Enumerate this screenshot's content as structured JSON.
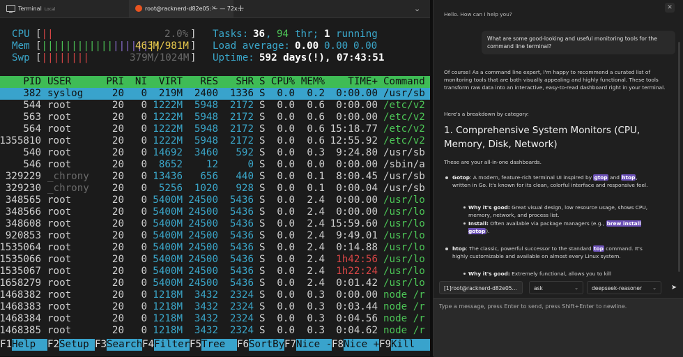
{
  "tabbar": {
    "tab1_title": "Terminal",
    "tab1_sub": "Local",
    "tab2_title": "root@racknerd-d82e05: ~ — 72x…",
    "close": "×",
    "new_tab": "+",
    "overflow": "⌄"
  },
  "meters": {
    "cpu_label": "CPU",
    "cpu_value": "2.0%",
    "mem_label": "Mem",
    "mem_value": "463M/981M",
    "swp_label": "Swp",
    "swp_value": "379M/1024M",
    "tasks_label": "Tasks:",
    "tasks_value": "36",
    "thr_value": "94",
    "thr_label": "thr;",
    "running_value": "1",
    "running_label": "running",
    "load_label": "Load average:",
    "load1": "0.00",
    "load5": "0.00",
    "load15": "0.00",
    "uptime_label": "Uptime:",
    "uptime_value": "592 days(!), 07:43:51"
  },
  "columns": [
    "PID",
    "USER",
    "PRI",
    "NI",
    "VIRT",
    "RES",
    "SHR",
    "S",
    "CPU%",
    "MEM%",
    "TIME+",
    "Command"
  ],
  "processes": [
    {
      "pid": "382",
      "user": "syslog",
      "pri": "20",
      "ni": "0",
      "virt": "219M",
      "res": "2400",
      "shr": "1336",
      "s": "S",
      "cpu": "0.0",
      "mem": "0.2",
      "time": "0:00.00",
      "cmd": "/usr/sb"
    },
    {
      "pid": "544",
      "user": "root",
      "pri": "20",
      "ni": "0",
      "virt": "1222M",
      "res": "5948",
      "shr": "2172",
      "s": "S",
      "cpu": "0.0",
      "mem": "0.6",
      "time": "0:00.00",
      "cmd": "/etc/v2"
    },
    {
      "pid": "563",
      "user": "root",
      "pri": "20",
      "ni": "0",
      "virt": "1222M",
      "res": "5948",
      "shr": "2172",
      "s": "S",
      "cpu": "0.0",
      "mem": "0.6",
      "time": "0:00.00",
      "cmd": "/etc/v2"
    },
    {
      "pid": "564",
      "user": "root",
      "pri": "20",
      "ni": "0",
      "virt": "1222M",
      "res": "5948",
      "shr": "2172",
      "s": "S",
      "cpu": "0.0",
      "mem": "0.6",
      "time": "15:18.77",
      "cmd": "/etc/v2"
    },
    {
      "pid": "1355810",
      "user": "root",
      "pri": "20",
      "ni": "0",
      "virt": "1222M",
      "res": "5948",
      "shr": "2172",
      "s": "S",
      "cpu": "0.0",
      "mem": "0.6",
      "time": "12:55.92",
      "cmd": "/etc/v2"
    },
    {
      "pid": "540",
      "user": "root",
      "pri": "20",
      "ni": "0",
      "virt": "14692",
      "res": "3460",
      "shr": "592",
      "s": "S",
      "cpu": "0.0",
      "mem": "0.3",
      "time": "9:24.80",
      "cmd": "/usr/sb"
    },
    {
      "pid": "546",
      "user": "root",
      "pri": "20",
      "ni": "0",
      "virt": "8652",
      "res": "12",
      "shr": "0",
      "s": "S",
      "cpu": "0.0",
      "mem": "0.0",
      "time": "0:00.00",
      "cmd": "/sbin/a"
    },
    {
      "pid": "329229",
      "user": "_chrony",
      "pri": "20",
      "ni": "0",
      "virt": "13436",
      "res": "656",
      "shr": "440",
      "s": "S",
      "cpu": "0.0",
      "mem": "0.1",
      "time": "8:00.45",
      "cmd": "/usr/sb"
    },
    {
      "pid": "329230",
      "user": "_chrony",
      "pri": "20",
      "ni": "0",
      "virt": "5256",
      "res": "1020",
      "shr": "928",
      "s": "S",
      "cpu": "0.0",
      "mem": "0.1",
      "time": "0:00.04",
      "cmd": "/usr/sb"
    },
    {
      "pid": "348565",
      "user": "root",
      "pri": "20",
      "ni": "0",
      "virt": "5400M",
      "res": "24500",
      "shr": "5436",
      "s": "S",
      "cpu": "0.0",
      "mem": "2.4",
      "time": "0:00.00",
      "cmd": "/usr/lo"
    },
    {
      "pid": "348566",
      "user": "root",
      "pri": "20",
      "ni": "0",
      "virt": "5400M",
      "res": "24500",
      "shr": "5436",
      "s": "S",
      "cpu": "0.0",
      "mem": "2.4",
      "time": "0:00.00",
      "cmd": "/usr/lo"
    },
    {
      "pid": "348608",
      "user": "root",
      "pri": "20",
      "ni": "0",
      "virt": "5400M",
      "res": "24500",
      "shr": "5436",
      "s": "S",
      "cpu": "0.0",
      "mem": "2.4",
      "time": "15:59.60",
      "cmd": "/usr/lo"
    },
    {
      "pid": "920853",
      "user": "root",
      "pri": "20",
      "ni": "0",
      "virt": "5400M",
      "res": "24500",
      "shr": "5436",
      "s": "S",
      "cpu": "0.0",
      "mem": "2.4",
      "time": "9:49.01",
      "cmd": "/usr/lo"
    },
    {
      "pid": "1535064",
      "user": "root",
      "pri": "20",
      "ni": "0",
      "virt": "5400M",
      "res": "24500",
      "shr": "5436",
      "s": "S",
      "cpu": "0.0",
      "mem": "2.4",
      "time": "0:14.88",
      "cmd": "/usr/lo"
    },
    {
      "pid": "1535066",
      "user": "root",
      "pri": "20",
      "ni": "0",
      "virt": "5400M",
      "res": "24500",
      "shr": "5436",
      "s": "S",
      "cpu": "0.0",
      "mem": "2.4",
      "time": "1h42:56",
      "cmd": "/usr/lo"
    },
    {
      "pid": "1535067",
      "user": "root",
      "pri": "20",
      "ni": "0",
      "virt": "5400M",
      "res": "24500",
      "shr": "5436",
      "s": "S",
      "cpu": "0.0",
      "mem": "2.4",
      "time": "1h22:24",
      "cmd": "/usr/lo"
    },
    {
      "pid": "1658279",
      "user": "root",
      "pri": "20",
      "ni": "0",
      "virt": "5400M",
      "res": "24500",
      "shr": "5436",
      "s": "S",
      "cpu": "0.0",
      "mem": "2.4",
      "time": "0:01.42",
      "cmd": "/usr/lo"
    },
    {
      "pid": "1468382",
      "user": "root",
      "pri": "20",
      "ni": "0",
      "virt": "1218M",
      "res": "3432",
      "shr": "2324",
      "s": "S",
      "cpu": "0.0",
      "mem": "0.3",
      "time": "0:00.00",
      "cmd": "node /r"
    },
    {
      "pid": "1468383",
      "user": "root",
      "pri": "20",
      "ni": "0",
      "virt": "1218M",
      "res": "3432",
      "shr": "2324",
      "s": "S",
      "cpu": "0.0",
      "mem": "0.3",
      "time": "0:03.44",
      "cmd": "node /r"
    },
    {
      "pid": "1468384",
      "user": "root",
      "pri": "20",
      "ni": "0",
      "virt": "1218M",
      "res": "3432",
      "shr": "2324",
      "s": "S",
      "cpu": "0.0",
      "mem": "0.3",
      "time": "0:04.56",
      "cmd": "node /r"
    },
    {
      "pid": "1468385",
      "user": "root",
      "pri": "20",
      "ni": "0",
      "virt": "1218M",
      "res": "3432",
      "shr": "2324",
      "s": "S",
      "cpu": "0.0",
      "mem": "0.3",
      "time": "0:04.62",
      "cmd": "node /r"
    }
  ],
  "fkeys": [
    {
      "key": "F1",
      "label": "Help"
    },
    {
      "key": "F2",
      "label": "Setup"
    },
    {
      "key": "F3",
      "label": "Search"
    },
    {
      "key": "F4",
      "label": "Filter"
    },
    {
      "key": "F5",
      "label": "Tree"
    },
    {
      "key": "F6",
      "label": "SortBy"
    },
    {
      "key": "F7",
      "label": "Nice -"
    },
    {
      "key": "F8",
      "label": "Nice +"
    },
    {
      "key": "F9",
      "label": "Kill"
    }
  ],
  "chat": {
    "greeting": "Hello. How can I help you?",
    "user_message": "What are some good-looking and useful monitoring tools for the command line terminal?",
    "intro": "Of course! As a command line expert, I'm happy to recommend a curated list of monitoring tools that are both visually appealing and highly functional. These tools transform raw data into an interactive, easy-to-read dashboard right in your terminal.",
    "breakdown": "Here's a breakdown by category:",
    "heading": "1. Comprehensive System Monitors (CPU, Memory, Disk, Network)",
    "section_intro": "These are your all-in-one dashboards.",
    "gotop_name": "Gotop",
    "gotop_text_a": ": A modern, feature-rich terminal UI inspired by ",
    "gotop_kw1": "gtop",
    "gotop_text_b": " and ",
    "gotop_kw2": "htop",
    "gotop_text_c": ", written in Go. It's known for its clean, colorful interface and responsive feel.",
    "gotop_why_label": "Why it's good:",
    "gotop_why": " Great visual design, low resource usage, shows CPU, memory, network, and process list.",
    "gotop_install_label": "Install:",
    "gotop_install": " Often available via package managers (e.g., ",
    "gotop_install_kw": "brew install gotop",
    "gotop_install_end": ").",
    "htop_name": "htop",
    "htop_text_a": ": The classic, powerful successor to the standard ",
    "htop_kw": "top",
    "htop_text_b": " command. It's highly customizable and available on almost every Linux system.",
    "htop_why_label": "Why it's good:",
    "htop_why": " Extremely functional, allows you to kill"
  },
  "toolbar": {
    "session": "[1]root@racknerd-d82e05...",
    "mode": "ask",
    "model": "deepseek-reasoner"
  },
  "input": {
    "placeholder": "Type a message, press Enter to send, press Shift+Enter to newline."
  },
  "colors": {
    "header_bg": "#3fbc55",
    "selected_bg": "#39a3cc",
    "keyword_bg": "#6d52b8"
  }
}
